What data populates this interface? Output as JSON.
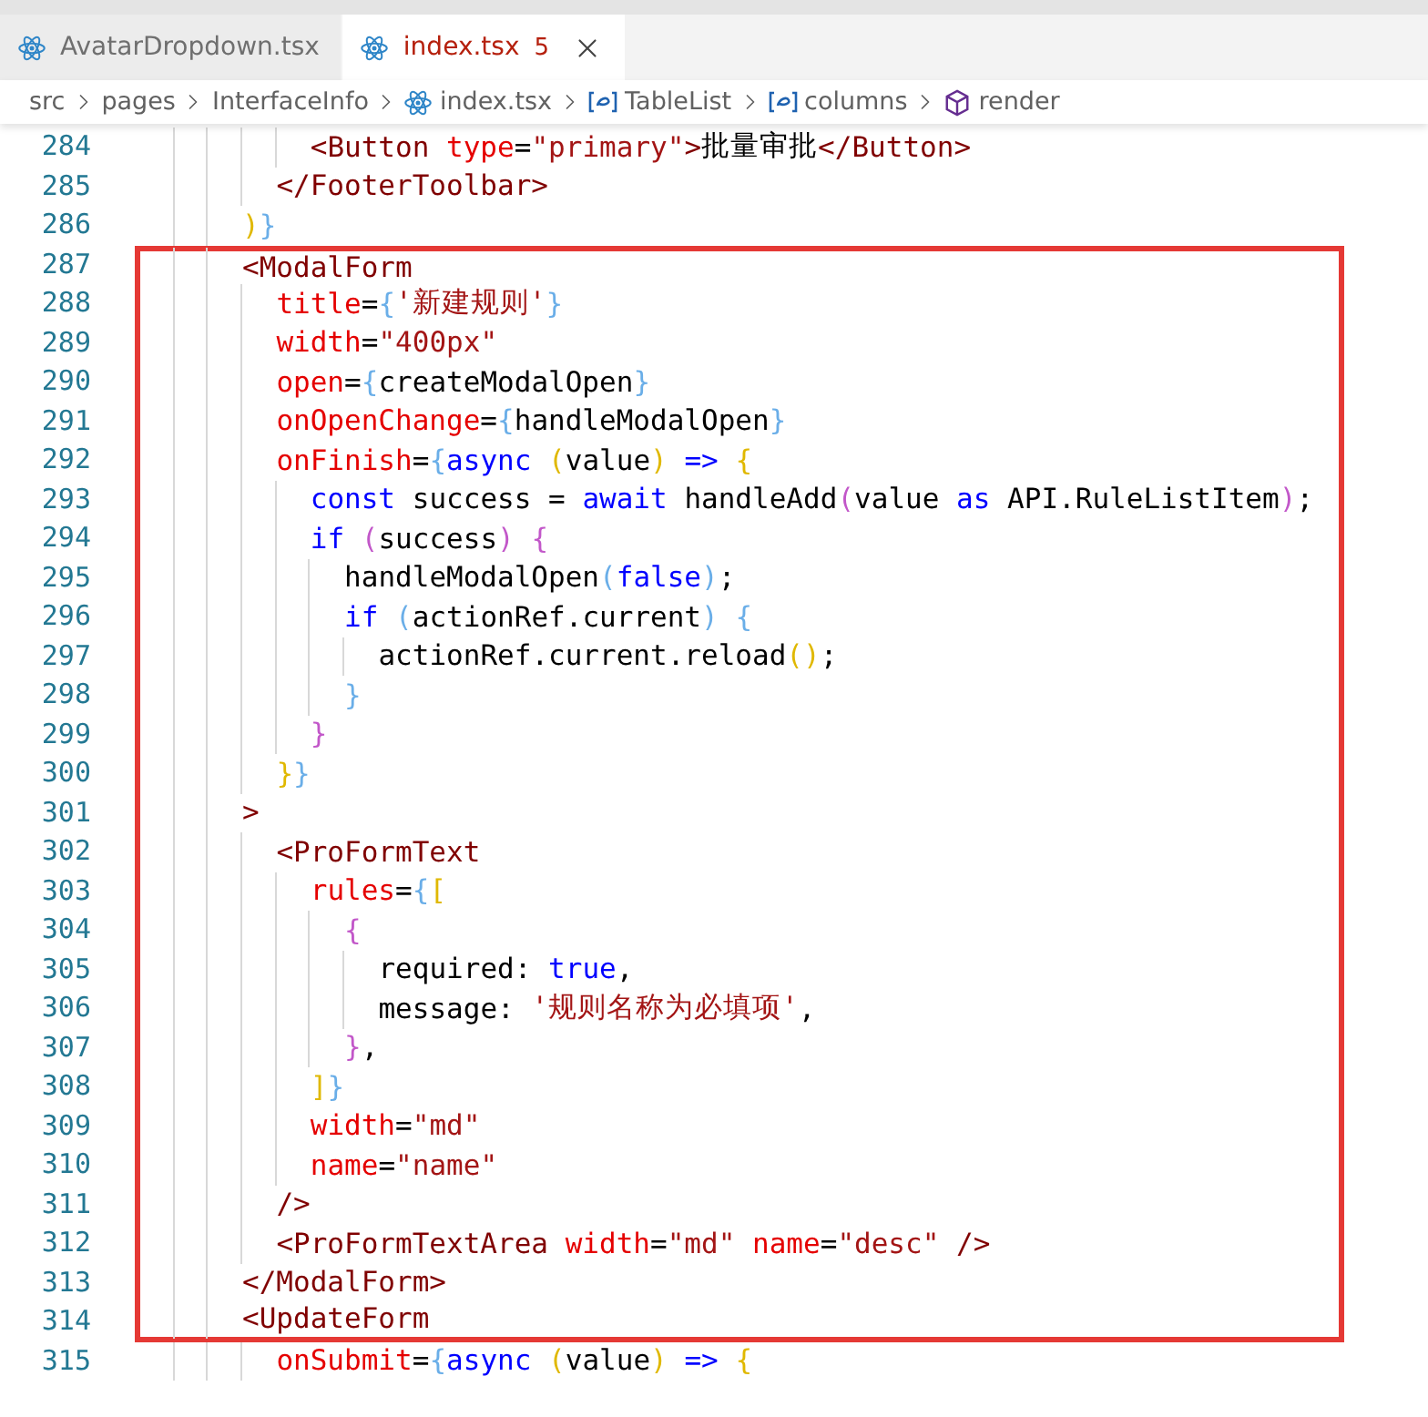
{
  "tabs": [
    {
      "label": "AvatarDropdown.tsx",
      "selected": false
    },
    {
      "label": "index.tsx",
      "selected": true,
      "problems": "5"
    }
  ],
  "breadcrumb": [
    {
      "label": "src",
      "kind": "folder"
    },
    {
      "label": "pages",
      "kind": "folder"
    },
    {
      "label": "InterfaceInfo",
      "kind": "folder"
    },
    {
      "label": "index.tsx",
      "kind": "file"
    },
    {
      "label": "TableList",
      "kind": "variable"
    },
    {
      "label": "columns",
      "kind": "variable"
    },
    {
      "label": "render",
      "kind": "method"
    }
  ],
  "lines": [
    {
      "number": "284",
      "highlighted": false,
      "tokens": [
        {
          "kind": "tag",
          "text": "          <Button"
        },
        {
          "kind": "attr",
          "text": " type"
        },
        {
          "kind": "plain",
          "text": "="
        },
        {
          "kind": "str",
          "text": "\"primary\""
        },
        {
          "kind": "tag",
          "text": ">"
        },
        {
          "kind": "plain",
          "text": "批量审批"
        },
        {
          "kind": "tag",
          "text": "</Button>"
        }
      ]
    },
    {
      "number": "285",
      "highlighted": false,
      "tokens": [
        {
          "kind": "tag",
          "text": "        </FooterToolbar>"
        }
      ]
    },
    {
      "number": "286",
      "highlighted": false,
      "tokens": [
        {
          "kind": "gold",
          "text": "      )"
        },
        {
          "kind": "sky",
          "text": "}"
        }
      ]
    },
    {
      "number": "287",
      "highlighted": true,
      "tokens": [
        {
          "kind": "tag",
          "text": "      <ModalForm"
        }
      ]
    },
    {
      "number": "288",
      "highlighted": true,
      "tokens": [
        {
          "kind": "attr",
          "text": "        title"
        },
        {
          "kind": "plain",
          "text": "="
        },
        {
          "kind": "sky",
          "text": "{"
        },
        {
          "kind": "str",
          "text": "'新建规则'"
        },
        {
          "kind": "sky",
          "text": "}"
        }
      ]
    },
    {
      "number": "289",
      "highlighted": true,
      "tokens": [
        {
          "kind": "attr",
          "text": "        width"
        },
        {
          "kind": "plain",
          "text": "="
        },
        {
          "kind": "str",
          "text": "\"400px\""
        }
      ]
    },
    {
      "number": "290",
      "highlighted": true,
      "tokens": [
        {
          "kind": "attr",
          "text": "        open"
        },
        {
          "kind": "plain",
          "text": "="
        },
        {
          "kind": "sky",
          "text": "{"
        },
        {
          "kind": "plain",
          "text": "createModalOpen"
        },
        {
          "kind": "sky",
          "text": "}"
        }
      ]
    },
    {
      "number": "291",
      "highlighted": true,
      "tokens": [
        {
          "kind": "attr",
          "text": "        onOpenChange"
        },
        {
          "kind": "plain",
          "text": "="
        },
        {
          "kind": "sky",
          "text": "{"
        },
        {
          "kind": "plain",
          "text": "handleModalOpen"
        },
        {
          "kind": "sky",
          "text": "}"
        }
      ]
    },
    {
      "number": "292",
      "highlighted": true,
      "tokens": [
        {
          "kind": "attr",
          "text": "        onFinish"
        },
        {
          "kind": "plain",
          "text": "="
        },
        {
          "kind": "sky",
          "text": "{"
        },
        {
          "kind": "kw",
          "text": "async"
        },
        {
          "kind": "gold",
          "text": " ("
        },
        {
          "kind": "plain",
          "text": "value"
        },
        {
          "kind": "gold",
          "text": ")"
        },
        {
          "kind": "kw",
          "text": " =>"
        },
        {
          "kind": "gold",
          "text": " {"
        }
      ]
    },
    {
      "number": "293",
      "highlighted": true,
      "tokens": [
        {
          "kind": "kw",
          "text": "          const"
        },
        {
          "kind": "plain",
          "text": " success = "
        },
        {
          "kind": "kw",
          "text": "await"
        },
        {
          "kind": "plain",
          "text": " handleAdd"
        },
        {
          "kind": "violet",
          "text": "("
        },
        {
          "kind": "plain",
          "text": "value "
        },
        {
          "kind": "kw",
          "text": "as"
        },
        {
          "kind": "plain",
          "text": " API.RuleListItem"
        },
        {
          "kind": "violet",
          "text": ")"
        },
        {
          "kind": "plain",
          "text": ";"
        }
      ]
    },
    {
      "number": "294",
      "highlighted": true,
      "tokens": [
        {
          "kind": "kw",
          "text": "          if"
        },
        {
          "kind": "violet",
          "text": " ("
        },
        {
          "kind": "plain",
          "text": "success"
        },
        {
          "kind": "violet",
          "text": ")"
        },
        {
          "kind": "violet",
          "text": " {"
        }
      ]
    },
    {
      "number": "295",
      "highlighted": true,
      "tokens": [
        {
          "kind": "plain",
          "text": "            handleModalOpen"
        },
        {
          "kind": "sky",
          "text": "("
        },
        {
          "kind": "kw",
          "text": "false"
        },
        {
          "kind": "sky",
          "text": ")"
        },
        {
          "kind": "plain",
          "text": ";"
        }
      ]
    },
    {
      "number": "296",
      "highlighted": true,
      "tokens": [
        {
          "kind": "kw",
          "text": "            if"
        },
        {
          "kind": "sky",
          "text": " ("
        },
        {
          "kind": "plain",
          "text": "actionRef.current"
        },
        {
          "kind": "sky",
          "text": ")"
        },
        {
          "kind": "sky",
          "text": " {"
        }
      ]
    },
    {
      "number": "297",
      "highlighted": true,
      "tokens": [
        {
          "kind": "plain",
          "text": "              actionRef.current.reload"
        },
        {
          "kind": "gold",
          "text": "()"
        },
        {
          "kind": "plain",
          "text": ";"
        }
      ]
    },
    {
      "number": "298",
      "highlighted": true,
      "tokens": [
        {
          "kind": "sky",
          "text": "            }"
        }
      ]
    },
    {
      "number": "299",
      "highlighted": true,
      "tokens": [
        {
          "kind": "violet",
          "text": "          }"
        }
      ]
    },
    {
      "number": "300",
      "highlighted": true,
      "tokens": [
        {
          "kind": "gold",
          "text": "        }"
        },
        {
          "kind": "sky",
          "text": "}"
        }
      ]
    },
    {
      "number": "301",
      "highlighted": true,
      "tokens": [
        {
          "kind": "tag",
          "text": "      >"
        }
      ]
    },
    {
      "number": "302",
      "highlighted": true,
      "tokens": [
        {
          "kind": "tag",
          "text": "        <ProFormText"
        }
      ]
    },
    {
      "number": "303",
      "highlighted": true,
      "tokens": [
        {
          "kind": "attr",
          "text": "          rules"
        },
        {
          "kind": "plain",
          "text": "="
        },
        {
          "kind": "sky",
          "text": "{"
        },
        {
          "kind": "gold",
          "text": "["
        }
      ]
    },
    {
      "number": "304",
      "highlighted": true,
      "tokens": [
        {
          "kind": "violet",
          "text": "            {"
        }
      ]
    },
    {
      "number": "305",
      "highlighted": true,
      "tokens": [
        {
          "kind": "plain",
          "text": "              required: "
        },
        {
          "kind": "kw",
          "text": "true"
        },
        {
          "kind": "plain",
          "text": ","
        }
      ]
    },
    {
      "number": "306",
      "highlighted": true,
      "tokens": [
        {
          "kind": "plain",
          "text": "              message: "
        },
        {
          "kind": "str",
          "text": "'规则名称为必填项'"
        },
        {
          "kind": "plain",
          "text": ","
        }
      ]
    },
    {
      "number": "307",
      "highlighted": true,
      "tokens": [
        {
          "kind": "violet",
          "text": "            }"
        },
        {
          "kind": "plain",
          "text": ","
        }
      ]
    },
    {
      "number": "308",
      "highlighted": true,
      "tokens": [
        {
          "kind": "gold",
          "text": "          ]"
        },
        {
          "kind": "sky",
          "text": "}"
        }
      ]
    },
    {
      "number": "309",
      "highlighted": true,
      "tokens": [
        {
          "kind": "attr",
          "text": "          width"
        },
        {
          "kind": "plain",
          "text": "="
        },
        {
          "kind": "str",
          "text": "\"md\""
        }
      ]
    },
    {
      "number": "310",
      "highlighted": true,
      "tokens": [
        {
          "kind": "attr",
          "text": "          name"
        },
        {
          "kind": "plain",
          "text": "="
        },
        {
          "kind": "str",
          "text": "\"name\""
        }
      ]
    },
    {
      "number": "311",
      "highlighted": true,
      "tokens": [
        {
          "kind": "tag",
          "text": "        />"
        }
      ]
    },
    {
      "number": "312",
      "highlighted": true,
      "tokens": [
        {
          "kind": "tag",
          "text": "        <ProFormTextArea"
        },
        {
          "kind": "attr",
          "text": " width"
        },
        {
          "kind": "plain",
          "text": "="
        },
        {
          "kind": "str",
          "text": "\"md\""
        },
        {
          "kind": "attr",
          "text": " name"
        },
        {
          "kind": "plain",
          "text": "="
        },
        {
          "kind": "str",
          "text": "\"desc\""
        },
        {
          "kind": "tag",
          "text": " />"
        }
      ]
    },
    {
      "number": "313",
      "highlighted": true,
      "tokens": [
        {
          "kind": "tag",
          "text": "      </ModalForm>"
        }
      ]
    },
    {
      "number": "314",
      "highlighted": true,
      "tokens": [
        {
          "kind": "tag",
          "text": "      <UpdateForm"
        }
      ]
    },
    {
      "number": "315",
      "highlighted": false,
      "tokens": [
        {
          "kind": "attr",
          "text": "        onSubmit"
        },
        {
          "kind": "plain",
          "text": "="
        },
        {
          "kind": "sky",
          "text": "{"
        },
        {
          "kind": "kw",
          "text": "async"
        },
        {
          "kind": "gold",
          "text": " ("
        },
        {
          "kind": "plain",
          "text": "value"
        },
        {
          "kind": "gold",
          "text": ")"
        },
        {
          "kind": "kw",
          "text": " =>"
        },
        {
          "kind": "gold",
          "text": " {"
        }
      ]
    }
  ]
}
